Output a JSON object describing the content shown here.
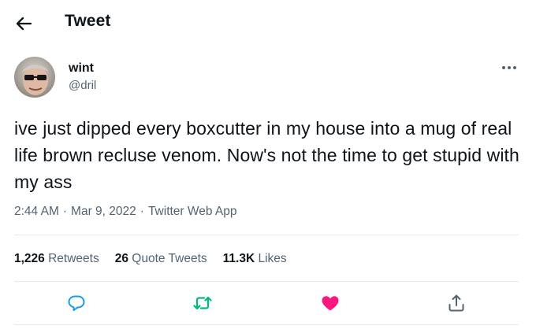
{
  "header": {
    "back_icon": "arrow-left-icon",
    "title": "Tweet"
  },
  "author": {
    "display_name": "wint",
    "handle": "@dril"
  },
  "tweet": {
    "text": "ive just dipped every boxcutter in my house into a mug of real life brown recluse venom. Now's not the time to get stupid with my ass",
    "time": "2:44 AM",
    "date": "Mar 9, 2022",
    "source": "Twitter Web App"
  },
  "stats": {
    "retweets_count": "1,226",
    "retweets_label": "Retweets",
    "quotes_count": "26",
    "quotes_label": "Quote Tweets",
    "likes_count": "11.3K",
    "likes_label": "Likes"
  },
  "actions": [
    {
      "name": "reply",
      "icon": "speech-bubble-icon",
      "color": "#1d9bf0"
    },
    {
      "name": "retweet",
      "icon": "retweet-arrows-icon",
      "color": "#00ba7c"
    },
    {
      "name": "like",
      "icon": "heart-icon",
      "color": "#f91880",
      "liked": true
    },
    {
      "name": "share",
      "icon": "share-upload-icon",
      "color": "#1d9bf0"
    }
  ]
}
